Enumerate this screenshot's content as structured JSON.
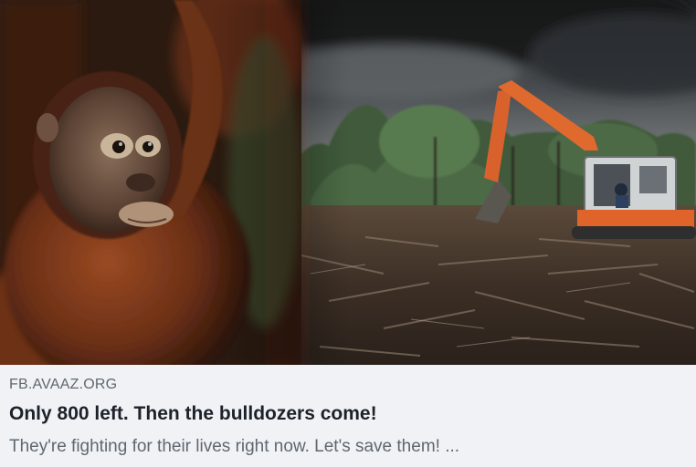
{
  "link_preview": {
    "image": {
      "subjects": [
        "orangutan",
        "excavator",
        "cleared-forest"
      ]
    },
    "domain": "FB.AVAAZ.ORG",
    "title": "Only 800 left. Then the bulldozers come!",
    "description": "They're fighting for their lives right now. Let's save them! ..."
  },
  "colors": {
    "caption_background": "#f0f2f5",
    "title_text": "#1d2129",
    "secondary_text": "#606770",
    "excavator_orange": "#e0632a",
    "orangutan_fur": "#7a3a1c"
  }
}
